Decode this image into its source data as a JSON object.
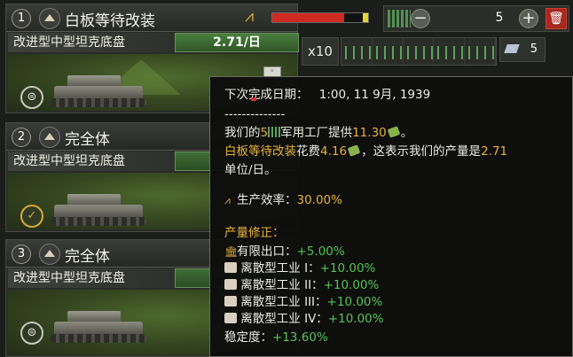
{
  "lines": [
    {
      "number": "1",
      "title": "白板等待改装",
      "design": "改进型中型坦克底盘",
      "output": "2.71/日",
      "status_icon": "upgrade-pending-icon"
    },
    {
      "number": "2",
      "title": "完全体",
      "design": "改进型中型坦克底盘",
      "output": "",
      "status_icon": "complete-check-icon"
    },
    {
      "number": "3",
      "title": "完全体",
      "design": "改进型中型坦克底盘",
      "output": "",
      "status_icon": "upgrade-pending-icon"
    }
  ],
  "toolbar": {
    "factory_count": "5",
    "efficiency_fill": 0.75,
    "multiplier": "x10",
    "resource_value": "5"
  },
  "tooltip": {
    "next_label": "下次完成日期：",
    "next_date": "1:00, 11 9月, 1939",
    "divider": "--------------",
    "p1": "我们的",
    "factories": "5",
    "p2": "军用工厂提供",
    "provided": "11.30",
    "p3": "。",
    "design_name": "白板等待改装",
    "p4": "花费",
    "cost": "4.16",
    "p5": "，这表示我们的产量是",
    "rate": "2.71",
    "unit": "单位/日。",
    "eff_label": "生产效率：",
    "eff_value": "30.00%",
    "mods_title": "产量修正：",
    "modifiers": [
      {
        "label": "有限出口：",
        "value": "+5.00%"
      },
      {
        "label": "离散型工业 I：",
        "value": "+10.00%"
      },
      {
        "label": "离散型工业 II：",
        "value": "+10.00%"
      },
      {
        "label": "离散型工业 III：",
        "value": "+10.00%"
      },
      {
        "label": "离散型工业 IV：",
        "value": "+10.00%"
      }
    ],
    "stability_label": "稳定度：",
    "stability_value": "+13.60%"
  }
}
